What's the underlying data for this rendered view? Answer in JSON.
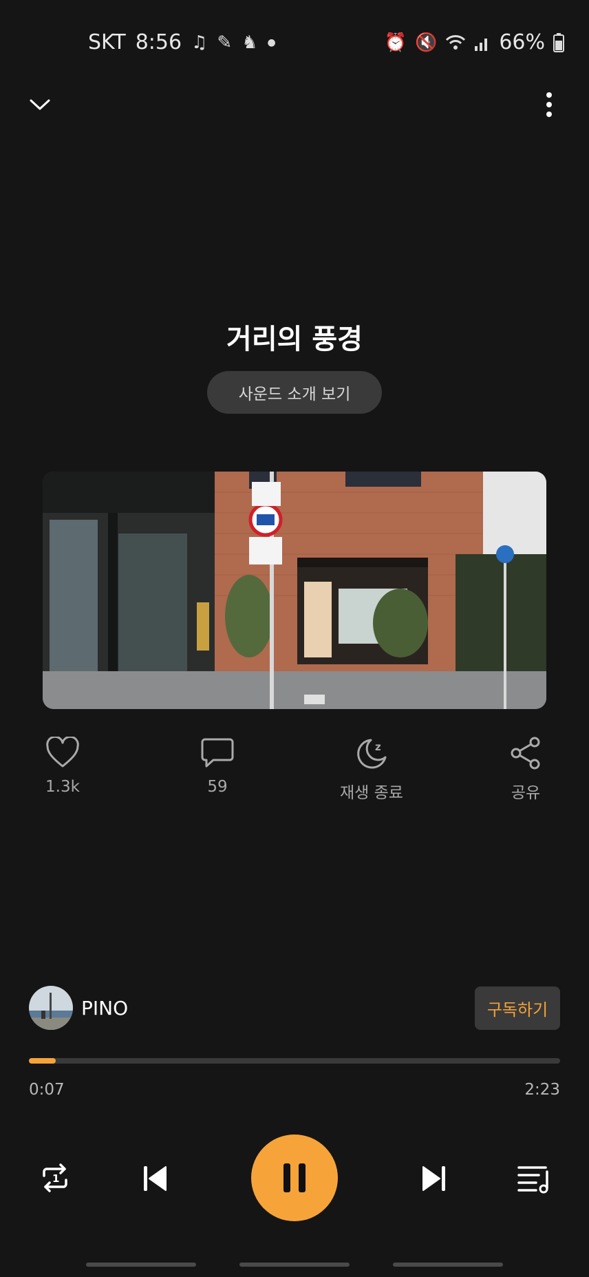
{
  "status_bar": {
    "carrier": "SKT",
    "time": "8:56",
    "battery": "66%",
    "left_icons": [
      "music-note-icon",
      "app-notification-icon",
      "app-notification-icon",
      "dot-icon"
    ],
    "right_icons": [
      "alarm-icon",
      "mute-icon",
      "wifi-icon",
      "signal-icon",
      "battery-icon"
    ]
  },
  "header": {
    "title": "거리의 풍경",
    "intro_button": "사운드 소개 보기"
  },
  "actions": {
    "like_count": "1.3k",
    "comment_count": "59",
    "sleep_label": "재생 종료",
    "share_label": "공유"
  },
  "artist": {
    "name": "PINO",
    "subscribe_label": "구독하기"
  },
  "playback": {
    "elapsed": "0:07",
    "duration": "2:23",
    "progress_fraction": 0.05
  },
  "colors": {
    "accent": "#f6a43a",
    "background": "#151515",
    "button_bg": "#3a3a3a"
  }
}
